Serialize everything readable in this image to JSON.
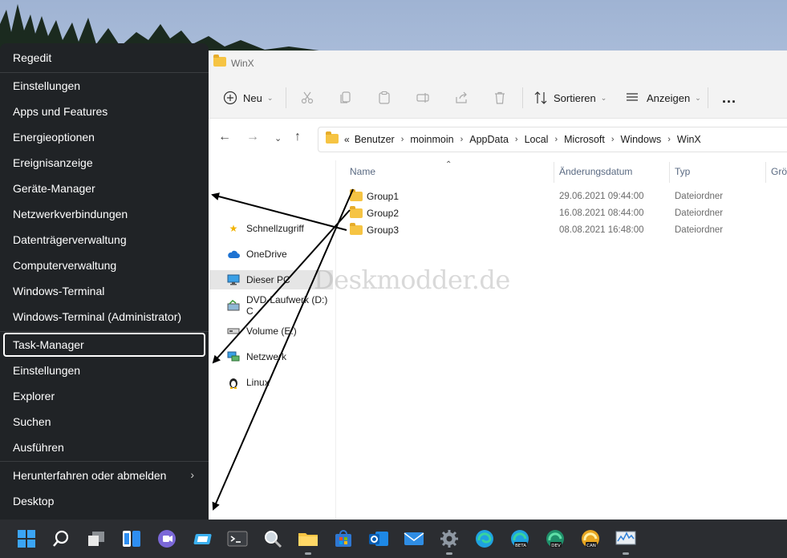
{
  "explorer": {
    "title": "WinX",
    "toolbar": {
      "new_label": "Neu",
      "sort_label": "Sortieren",
      "view_label": "Anzeigen",
      "more_label": "..."
    },
    "breadcrumb": [
      "Benutzer",
      "moinmoin",
      "AppData",
      "Local",
      "Microsoft",
      "Windows",
      "WinX"
    ],
    "navpane": [
      {
        "label": "Schnellzugriff",
        "icon": "star-icon"
      },
      {
        "label": "OneDrive",
        "icon": "cloud-icon"
      },
      {
        "label": "Dieser PC",
        "icon": "monitor-icon"
      },
      {
        "label": "DVD-Laufwerk (D:) C",
        "icon": "dvd-icon"
      },
      {
        "label": "Volume (E:)",
        "icon": "drive-icon"
      },
      {
        "label": "Netzwerk",
        "icon": "network-icon"
      },
      {
        "label": "Linux",
        "icon": "linux-penguin-icon"
      }
    ],
    "columns": {
      "name": "Name",
      "date": "Änderungsdatum",
      "type": "Typ",
      "size": "Grö"
    },
    "rows": [
      {
        "name": "Group1",
        "date": "29.06.2021 09:44:00",
        "type": "Dateiordner"
      },
      {
        "name": "Group2",
        "date": "16.08.2021 08:44:00",
        "type": "Dateiordner"
      },
      {
        "name": "Group3",
        "date": "08.08.2021 16:48:00",
        "type": "Dateiordner"
      }
    ],
    "watermark": "Deskmodder.de"
  },
  "winx_menu": {
    "items": [
      {
        "label": "Regedit"
      },
      {
        "label": "Einstellungen"
      },
      {
        "label": "Apps und Features"
      },
      {
        "label": "Energieoptionen"
      },
      {
        "label": "Ereignisanzeige"
      },
      {
        "label": "Geräte-Manager"
      },
      {
        "label": "Netzwerkverbindungen"
      },
      {
        "label": "Datenträgerverwaltung"
      },
      {
        "label": "Computerverwaltung"
      },
      {
        "label": "Windows-Terminal"
      },
      {
        "label": "Windows-Terminal (Administrator)"
      },
      {
        "label": "Task-Manager"
      },
      {
        "label": "Einstellungen"
      },
      {
        "label": "Explorer"
      },
      {
        "label": "Suchen"
      },
      {
        "label": "Ausführen"
      },
      {
        "label": "Herunterfahren oder abmelden"
      },
      {
        "label": "Desktop"
      }
    ],
    "focused": "Task-Manager",
    "chevron": "›"
  },
  "taskbar": {
    "icons": [
      "windows-start-icon",
      "search-icon",
      "task-view-icon",
      "widgets-icon",
      "teams-chat-icon",
      "remote-desktop-icon",
      "terminal-icon",
      "magnifier-icon",
      "file-explorer-icon",
      "store-icon",
      "outlook-icon",
      "mail-icon",
      "settings-icon",
      "edge-icon",
      "edge-beta-icon",
      "edge-dev-icon",
      "edge-canary-icon",
      "resource-monitor-icon"
    ],
    "badges": {
      "beta": "BETA",
      "dev": "DEV",
      "can": "CAN"
    }
  },
  "colors": {
    "menu_bg": "#202326",
    "taskbar_bg": "#2b2d31",
    "accent": "#0067c0",
    "folder": "#f6c443"
  }
}
